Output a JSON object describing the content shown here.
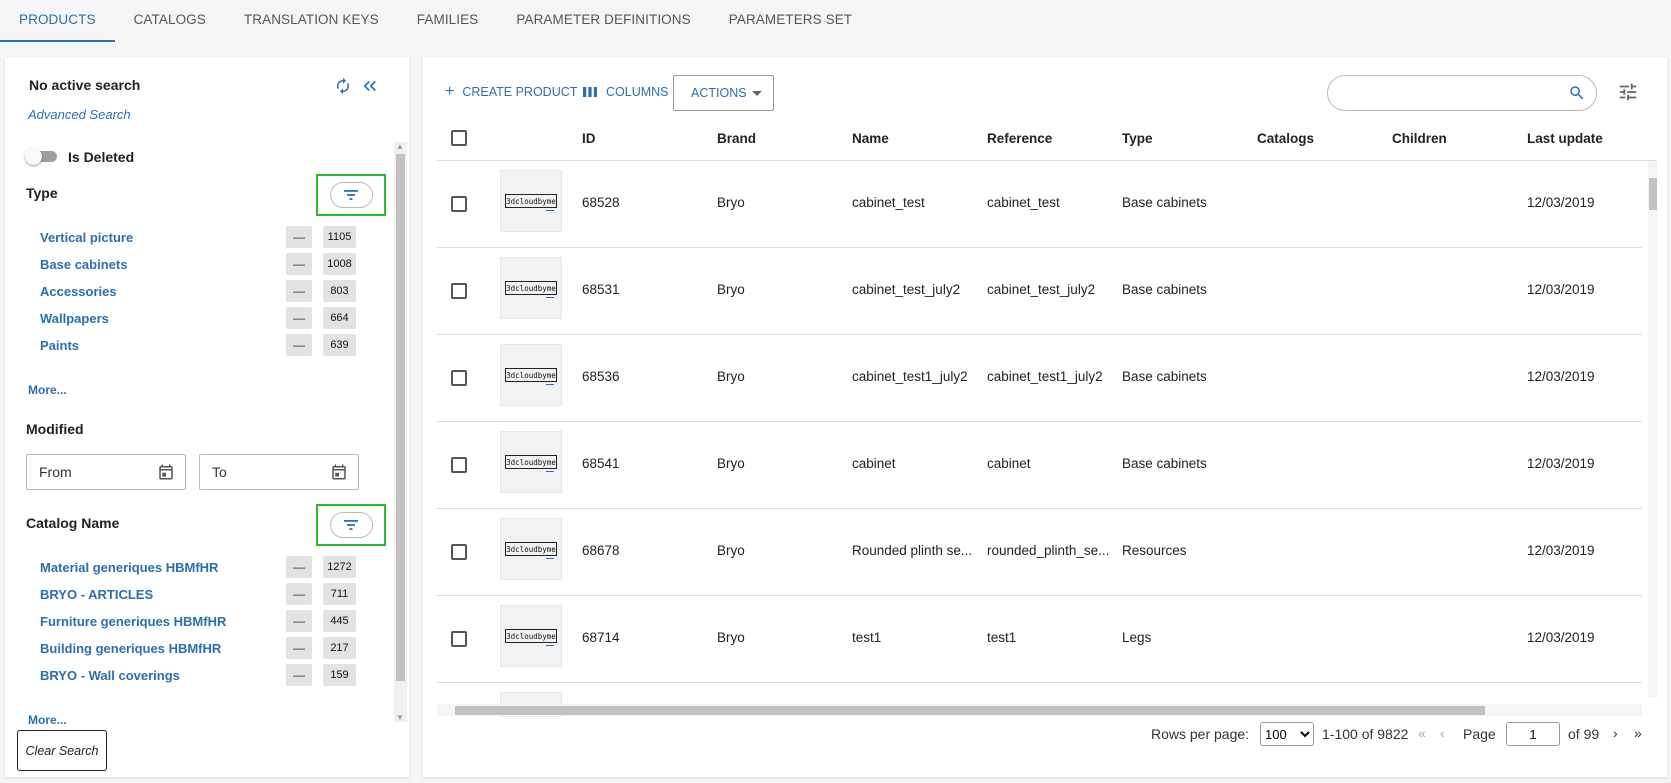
{
  "tabs": [
    {
      "label": "PRODUCTS"
    },
    {
      "label": "CATALOGS"
    },
    {
      "label": "TRANSLATION KEYS"
    },
    {
      "label": "FAMILIES"
    },
    {
      "label": "PARAMETER DEFINITIONS"
    },
    {
      "label": "PARAMETERS SET"
    }
  ],
  "sidebar": {
    "search_status": "No active search",
    "advanced_search": "Advanced Search",
    "is_deleted_label": "Is Deleted",
    "type_title": "Type",
    "type_facets": [
      {
        "label": "Vertical picture",
        "count": "1105"
      },
      {
        "label": "Base cabinets",
        "count": "1008"
      },
      {
        "label": "Accessories",
        "count": "803"
      },
      {
        "label": "Wallpapers",
        "count": "664"
      },
      {
        "label": "Paints",
        "count": "639"
      }
    ],
    "more_label": "More...",
    "modified_title": "Modified",
    "from_placeholder": "From",
    "to_placeholder": "To",
    "catalog_title": "Catalog Name",
    "catalog_facets": [
      {
        "label": "Material generiques HBMfHR",
        "count": "1272"
      },
      {
        "label": "BRYO - ARTICLES",
        "count": "711"
      },
      {
        "label": "Furniture generiques HBMfHR",
        "count": "445"
      },
      {
        "label": "Building generiques HBMfHR",
        "count": "217"
      },
      {
        "label": "BRYO - Wall coverings",
        "count": "159"
      }
    ],
    "clear_search": "Clear Search",
    "minus_symbol": "—"
  },
  "toolbar": {
    "create_product": "CREATE PRODUCT",
    "columns": "COLUMNS",
    "actions": "ACTIONS",
    "search_value": ""
  },
  "table": {
    "columns": [
      "ID",
      "Brand",
      "Name",
      "Reference",
      "Type",
      "Catalogs",
      "Children",
      "Last update"
    ],
    "thumbnail_text": "3dcloudbyme",
    "rows": [
      {
        "id": "68528",
        "brand": "Bryo",
        "name": "cabinet_test",
        "reference": "cabinet_test",
        "type": "Base cabinets",
        "catalogs": "",
        "children": "",
        "last_update": "12/03/2019"
      },
      {
        "id": "68531",
        "brand": "Bryo",
        "name": "cabinet_test_july2",
        "reference": "cabinet_test_july2",
        "type": "Base cabinets",
        "catalogs": "",
        "children": "",
        "last_update": "12/03/2019"
      },
      {
        "id": "68536",
        "brand": "Bryo",
        "name": "cabinet_test1_july2",
        "reference": "cabinet_test1_july2",
        "type": "Base cabinets",
        "catalogs": "",
        "children": "",
        "last_update": "12/03/2019"
      },
      {
        "id": "68541",
        "brand": "Bryo",
        "name": "cabinet",
        "reference": "cabinet",
        "type": "Base cabinets",
        "catalogs": "",
        "children": "",
        "last_update": "12/03/2019"
      },
      {
        "id": "68678",
        "brand": "Bryo",
        "name": "Rounded plinth se...",
        "reference": "rounded_plinth_se...",
        "type": "Resources",
        "catalogs": "",
        "children": "",
        "last_update": "12/03/2019"
      },
      {
        "id": "68714",
        "brand": "Bryo",
        "name": "test1",
        "reference": "test1",
        "type": "Legs",
        "catalogs": "",
        "children": "",
        "last_update": "12/03/2019"
      }
    ]
  },
  "pagination": {
    "rows_per_page_label": "Rows per page:",
    "rows_per_page_value": "100",
    "range": "1-100 of 9822",
    "page_label": "Page",
    "page_value": "1",
    "of_pages": "of 99",
    "first": "«",
    "prev": "‹",
    "next": "›",
    "last": "»"
  },
  "colors": {
    "accent": "#2a6fb0",
    "highlight_box": "#2eb82e"
  }
}
